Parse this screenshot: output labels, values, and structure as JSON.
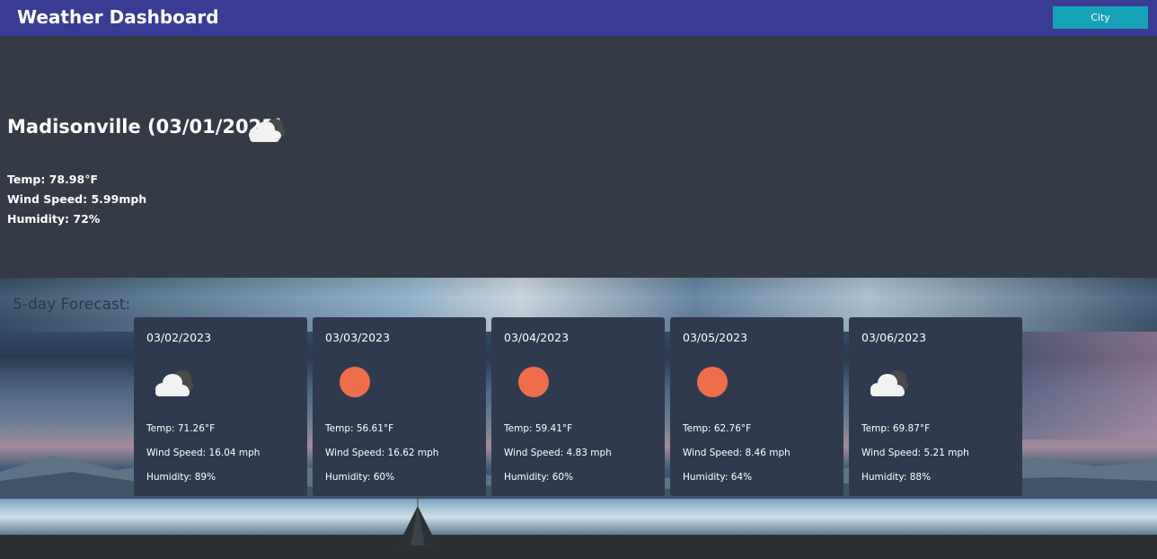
{
  "header": {
    "title": "Weather Dashboard",
    "city_button": "City"
  },
  "current": {
    "title": "Madisonville (03/01/2023)",
    "icon": "cloudy-icon",
    "temp": "Temp: 78.98°F",
    "wind": "Wind Speed: 5.99mph",
    "humidity": "Humidity: 72%"
  },
  "forecast": {
    "title": "5-day Forecast:",
    "days": [
      {
        "date": "03/02/2023",
        "icon": "cloudy-icon",
        "temp": "Temp: 71.26°F",
        "wind": "Wind Speed: 16.04 mph",
        "humidity": "Humidity: 89%"
      },
      {
        "date": "03/03/2023",
        "icon": "sun-icon",
        "temp": "Temp: 56.61°F",
        "wind": "Wind Speed: 16.62 mph",
        "humidity": "Humidity: 60%"
      },
      {
        "date": "03/04/2023",
        "icon": "sun-icon",
        "temp": "Temp: 59.41°F",
        "wind": "Wind Speed: 4.83 mph",
        "humidity": "Humidity: 60%"
      },
      {
        "date": "03/05/2023",
        "icon": "sun-icon",
        "temp": "Temp: 62.76°F",
        "wind": "Wind Speed: 8.46 mph",
        "humidity": "Humidity: 64%"
      },
      {
        "date": "03/06/2023",
        "icon": "cloudy-icon",
        "temp": "Temp: 69.87°F",
        "wind": "Wind Speed: 5.21 mph",
        "humidity": "Humidity: 88%"
      }
    ]
  },
  "colors": {
    "navbar": "#3a3c94",
    "button": "#17a2b8",
    "card": "#2f3a4e",
    "sun": "#ee6e4c",
    "panel": "#343a46"
  }
}
